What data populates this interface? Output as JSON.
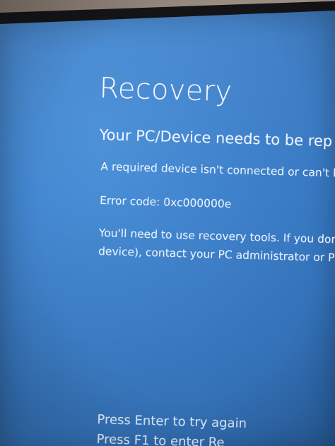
{
  "screen": {
    "title": "Recovery",
    "subtitle": "Your PC/Device needs to be rep",
    "message": "A required device isn't connected or can't be",
    "error_code": "Error code: 0xc000000e",
    "instructions_line1": "You'll need to use recovery tools. If you don't",
    "instructions_line2": "device), contact your PC administrator or PC/D",
    "footer_enter": "Press Enter to try again",
    "footer_f1": "Press F1 to enter Re"
  },
  "colors": {
    "screen_blue": "#3f82cc",
    "text": "#eaf2ff",
    "bezel": "#141417"
  }
}
